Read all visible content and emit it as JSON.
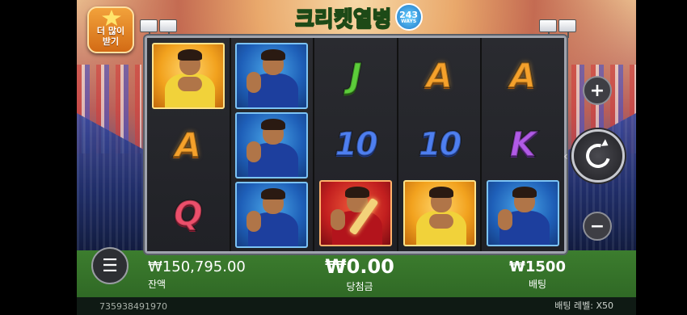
{
  "title": {
    "text": "크리켓열병",
    "ways_number": "243",
    "ways_label": "WAYS"
  },
  "more_badge": {
    "label": "더 많이\n받기"
  },
  "reels": [
    [
      "player-gold",
      "A",
      "Q"
    ],
    [
      "player-blue",
      "player-blue",
      "player-blue"
    ],
    [
      "J",
      "10",
      "player-red-bat"
    ],
    [
      "A",
      "10",
      "player-gold"
    ],
    [
      "A",
      "K",
      "player-blue"
    ]
  ],
  "balance": {
    "value": "₩150,795.00",
    "label": "잔액"
  },
  "win": {
    "value": "₩0.00",
    "label": "당첨금"
  },
  "bet": {
    "value": "₩1500",
    "label": "배팅"
  },
  "controls": {
    "plus": "+",
    "minus": "−",
    "menu": "☰",
    "spin_pointer": "‹"
  },
  "footer": {
    "session_id": "735938491970",
    "bet_level": "배팅 레벨:  X50"
  },
  "colors": {
    "accent_title": "#bff26a",
    "symbol_A": "#f5a12b",
    "symbol_J": "#5ccd3a",
    "symbol_10": "#4e7ff0",
    "symbol_K": "#b15ae6",
    "symbol_Q": "#ec4f6b"
  }
}
